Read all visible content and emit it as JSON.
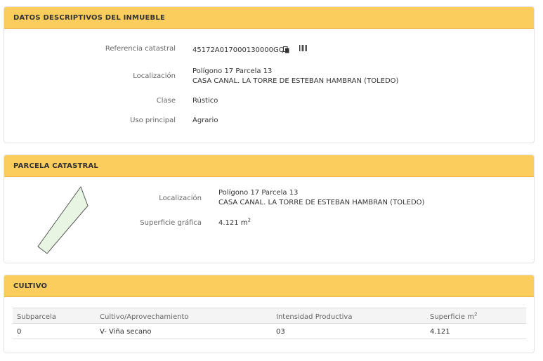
{
  "datos": {
    "title": "DATOS DESCRIPTIVOS DEL INMUEBLE",
    "ref_label": "Referencia catastral",
    "ref_value": "45172A017000130000GQ",
    "loc_label": "Localización",
    "loc_line1": "Polígono 17 Parcela 13",
    "loc_line2": "CASA CANAL. LA TORRE DE ESTEBAN HAMBRAN (TOLEDO)",
    "clase_label": "Clase",
    "clase_value": "Rústico",
    "uso_label": "Uso principal",
    "uso_value": "Agrario"
  },
  "parcela": {
    "title": "PARCELA CATASTRAL",
    "loc_label": "Localización",
    "loc_line1": "Polígono 17 Parcela 13",
    "loc_line2": "CASA CANAL. LA TORRE DE ESTEBAN HAMBRAN (TOLEDO)",
    "sup_label": "Superficie gráfica",
    "sup_value": "4.121 m",
    "sup_exp": "2"
  },
  "cultivo": {
    "title": "CULTIVO",
    "headers": {
      "subparcela": "Subparcela",
      "cultivo": "Cultivo/Aprovechamiento",
      "intensidad": "Intensidad Productiva",
      "superficie": "Superficie m",
      "superficie_exp": "2"
    },
    "rows": [
      {
        "subparcela": "0",
        "cultivo": "V- Viña secano",
        "intensidad": "03",
        "superficie": "4.121"
      }
    ]
  },
  "colors": {
    "header_bg": "#fbcd5d",
    "parcel_fill": "#e9f5e3",
    "parcel_stroke": "#555555"
  },
  "icons": [
    "copy-icon",
    "barcode-icon"
  ]
}
